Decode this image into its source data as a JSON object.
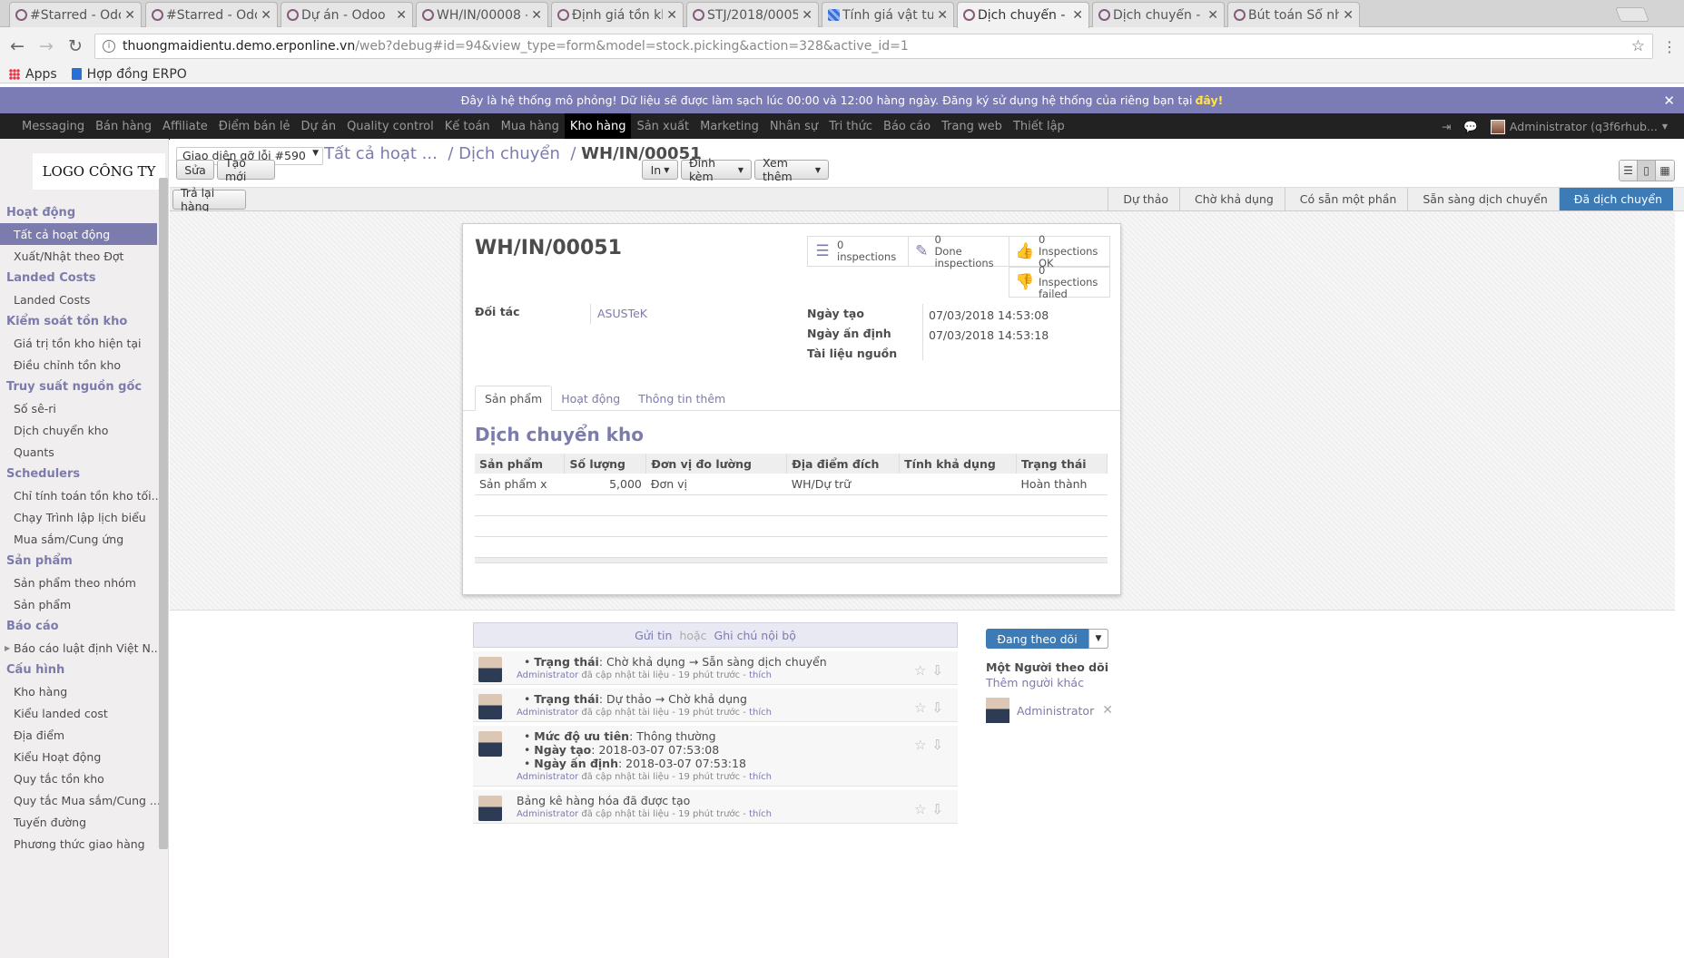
{
  "browser": {
    "tabs": [
      {
        "title": "#Starred - Odoo",
        "icon": "odoo-icon"
      },
      {
        "title": "#Starred - Odoo",
        "icon": "odoo-icon"
      },
      {
        "title": "Dự án - Odoo",
        "icon": "odoo-icon"
      },
      {
        "title": "WH/IN/00008 - O",
        "icon": "odoo-icon"
      },
      {
        "title": "Định giá tồn kho",
        "icon": "odoo-icon"
      },
      {
        "title": "STJ/2018/0005 - I",
        "icon": "odoo-icon"
      },
      {
        "title": "Tính giá vật tư",
        "icon": "grid-icon"
      },
      {
        "title": "Dịch chuyển - O",
        "icon": "odoo-icon",
        "active": true
      },
      {
        "title": "Dịch chuyển - O",
        "icon": "odoo-icon"
      },
      {
        "title": "Bút toán Sổ nhậ",
        "icon": "odoo-icon"
      }
    ],
    "url_host": "thuongmaidientu.demo.erponline.vn",
    "url_path": "/web?debug#id=94&view_type=form&model=stock.picking&action=328&active_id=1",
    "bookmarks": [
      "Apps",
      "Hợp đồng ERPO"
    ]
  },
  "banner": {
    "text": "Đây là hệ thống mô phỏng! Dữ liệu sẽ được làm sạch lúc 00:00 và 12:00 hàng ngày. Đăng ký sử dụng hệ thống của riêng bạn tại",
    "link": "đây!"
  },
  "topmenu": [
    "Messaging",
    "Bán hàng",
    "Affiliate",
    "Điểm bán lẻ",
    "Dự án",
    "Quality control",
    "Kế toán",
    "Mua hàng",
    "Kho hàng",
    "Sản xuất",
    "Marketing",
    "Nhân sự",
    "Tri thức",
    "Báo cáo",
    "Trang web",
    "Thiết lập"
  ],
  "user": "Administrator (q3f6rhub...",
  "logo_text": "LOGO CÔNG TY",
  "sidebar": [
    {
      "section": "Hoạt động",
      "items": [
        "Tất cả hoạt động",
        "Xuất/Nhật theo Đợt"
      ]
    },
    {
      "section": "Landed Costs",
      "items": [
        "Landed Costs"
      ]
    },
    {
      "section": "Kiểm soát tồn kho",
      "items": [
        "Giá trị tồn kho hiện tại",
        "Điều chỉnh tồn kho"
      ]
    },
    {
      "section": "Truy suất nguồn gốc",
      "items": [
        "Số sê-ri",
        "Dịch chuyển kho",
        "Quants"
      ]
    },
    {
      "section": "Schedulers",
      "items": [
        "Chỉ tính toán tồn kho tối...",
        "Chạy Trình lập lịch biểu",
        "Mua sắm/Cung ứng"
      ]
    },
    {
      "section": "Sản phẩm",
      "items": [
        "Sản phẩm theo nhóm",
        "Sản phẩm"
      ]
    },
    {
      "section": "Báo cáo",
      "items": [
        "Báo cáo luật định Việt N..."
      ]
    },
    {
      "section": "Cấu hình",
      "items": [
        "Kho hàng",
        "Kiểu landed cost",
        "Địa điểm",
        "Kiểu Hoạt động",
        "Quy tắc tồn kho",
        "Quy tắc Mua sắm/Cung ...",
        "Tuyến đường",
        "Phương thức giao hàng"
      ]
    }
  ],
  "control": {
    "view_select": "Giao diện gỡ lỗi #590",
    "breadcrumb_1": "Tất cả hoạt ...",
    "breadcrumb_2": "Dịch chuyển",
    "breadcrumb_sep": "/",
    "breadcrumb_cur": "WH/IN/00051",
    "edit": "Sửa",
    "create": "Tạo mới",
    "print": "In",
    "attach": "Đính kèm",
    "more": "Xem thêm",
    "return": "Trả lại hàng"
  },
  "status_steps": [
    "Dự thảo",
    "Chờ khả dụng",
    "Có sẵn một phần",
    "Sẵn sàng dịch chuyển",
    "Đã dịch chuyển"
  ],
  "record": {
    "name": "WH/IN/00051",
    "smart_buttons": [
      {
        "count": "0",
        "label": "inspections",
        "icon": "list-icon"
      },
      {
        "count": "0",
        "label": "Done inspections",
        "icon": "pencil-icon"
      },
      {
        "count": "0",
        "label": "Inspections OK",
        "icon": "thumbs-up-icon"
      },
      {
        "count": "0",
        "label": "Inspections failed",
        "icon": "thumbs-down-icon"
      }
    ],
    "partner_label": "Đối tác",
    "partner": "ASUSTeK",
    "date_label": "Ngày tạo",
    "date": "07/03/2018 14:53:08",
    "scheduled_label": "Ngày ấn định",
    "scheduled": "07/03/2018 14:53:18",
    "origin_label": "Tài liệu nguồn",
    "tabs": [
      "Sản phẩm",
      "Hoạt động",
      "Thông tin thêm"
    ],
    "section_title": "Dịch chuyển kho",
    "columns": [
      "Sản phẩm",
      "Số lượng",
      "Đơn vị đo lường",
      "Địa điểm đích",
      "Tính khả dụng",
      "Trạng thái"
    ],
    "rows": [
      [
        "Sản phẩm x",
        "5,000",
        "Đơn vị",
        "WH/Dự trữ",
        "",
        "Hoàn thành"
      ]
    ]
  },
  "chatter": {
    "send": "Gửi tin",
    "or": "hoặc",
    "note": "Ghi chú nội bộ",
    "messages": [
      {
        "lines": [
          {
            "k": "Trạng thái",
            "v": "Chờ khả dụng → Sẵn sàng dịch chuyển"
          }
        ],
        "author": "Administrator",
        "meta": "đã cập nhật tài liệu - 19 phút trước -",
        "like": "thích"
      },
      {
        "lines": [
          {
            "k": "Trạng thái",
            "v": "Dự thảo → Chờ khả dụng"
          }
        ],
        "author": "Administrator",
        "meta": "đã cập nhật tài liệu - 19 phút trước -",
        "like": "thích"
      },
      {
        "lines": [
          {
            "k": "Mức độ ưu tiên",
            "v": "Thông thường"
          },
          {
            "k": "Ngày tạo",
            "v": "2018-03-07 07:53:08"
          },
          {
            "k": "Ngày ấn định",
            "v": "2018-03-07 07:53:18"
          }
        ],
        "author": "Administrator",
        "meta": "đã cập nhật tài liệu - 19 phút trước -",
        "like": "thích"
      },
      {
        "text": "Bảng kê hàng hóa đã được tạo",
        "author": "Administrator",
        "meta": "đã cập nhật tài liệu - 19 phút trước -",
        "like": "thích"
      }
    ],
    "follow_btn": "Đang theo dõi",
    "followers_title": "Một Người theo dõi",
    "add_followers": "Thêm người khác",
    "follower": "Administrator"
  }
}
